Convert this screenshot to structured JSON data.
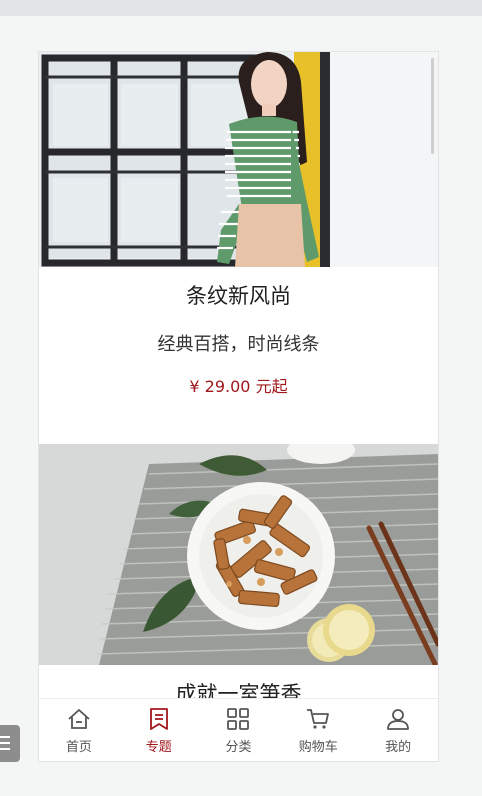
{
  "cards": [
    {
      "title": "条纹新风尚",
      "subtitle": "经典百搭，时尚线条",
      "price": "¥ 29.00 元起",
      "image": "woman-striped-shirt-photo"
    },
    {
      "title": "成就一室笋香",
      "image": "bamboo-shoots-plate-photo"
    }
  ],
  "tabbar": {
    "items": [
      {
        "label": "首页",
        "icon": "home-icon",
        "active": false
      },
      {
        "label": "专题",
        "icon": "topic-icon",
        "active": true
      },
      {
        "label": "分类",
        "icon": "category-icon",
        "active": false
      },
      {
        "label": "购物车",
        "icon": "cart-icon",
        "active": false
      },
      {
        "label": "我的",
        "icon": "profile-icon",
        "active": false
      }
    ]
  },
  "colors": {
    "accent": "#a0181c",
    "tab_inactive": "#555555",
    "background": "#f4f5f5"
  }
}
